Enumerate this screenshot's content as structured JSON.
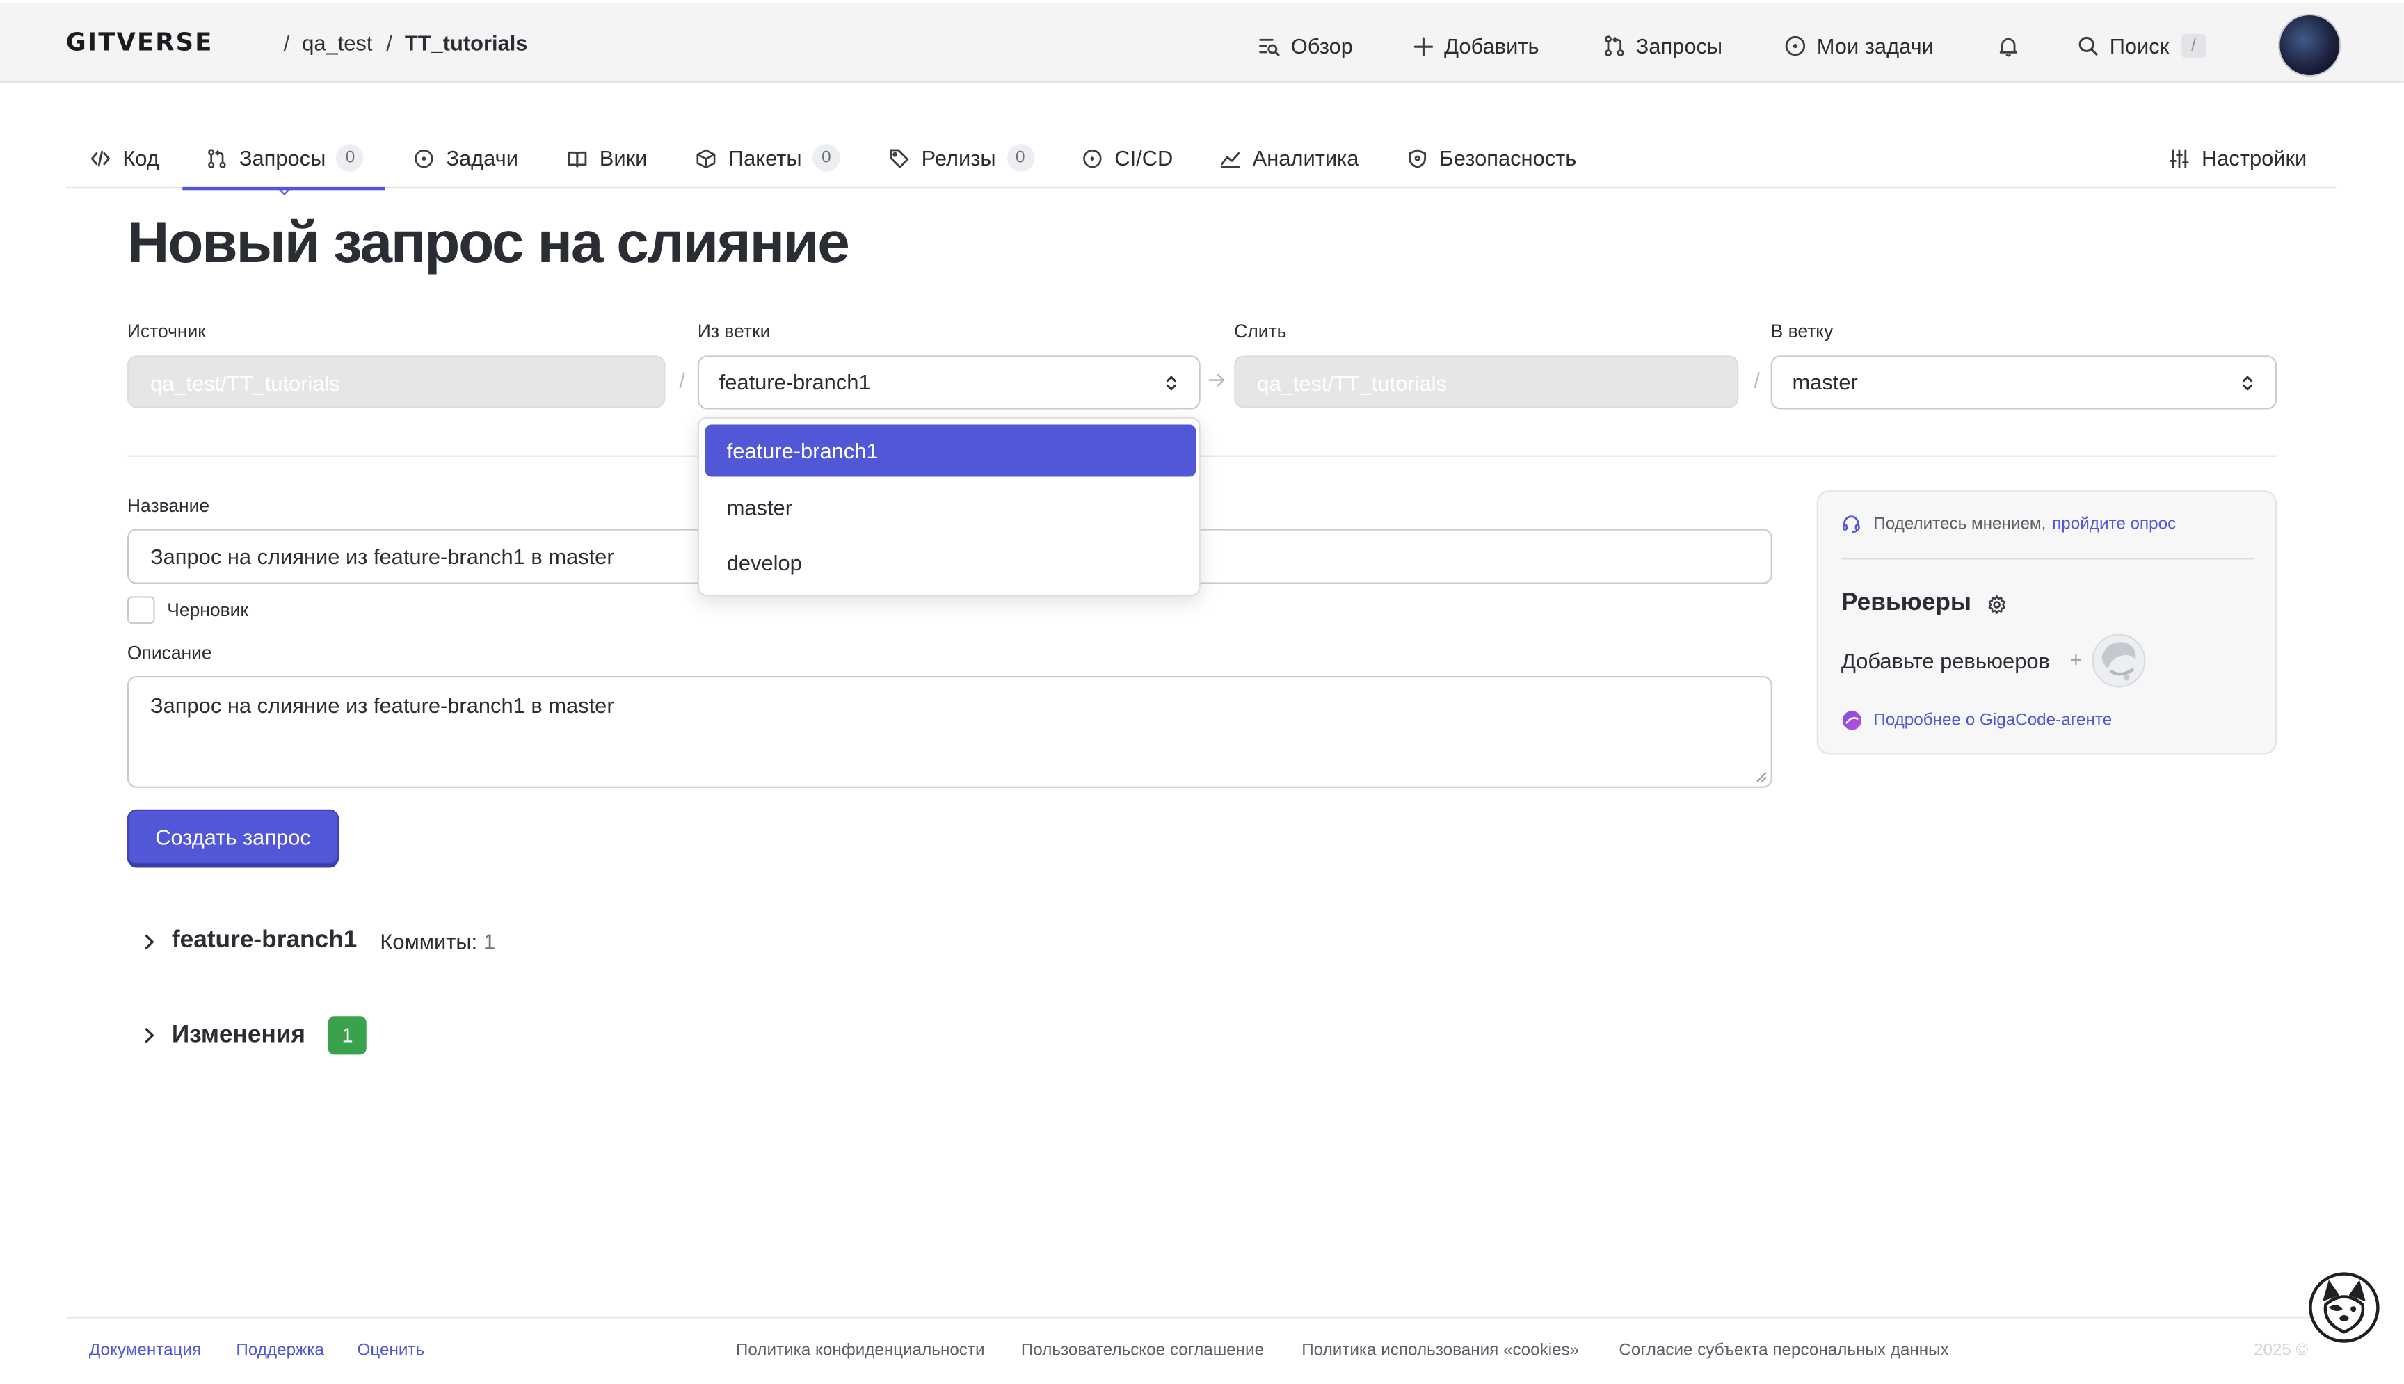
{
  "header": {
    "logo": "GITVERSE",
    "breadcrumb": {
      "owner": "qa_test",
      "separator": "/",
      "repo": "TT_tutorials"
    },
    "nav": {
      "overview": "Обзор",
      "add": "Добавить",
      "requests": "Запросы",
      "my_tasks": "Мои задачи",
      "search": "Поиск",
      "search_shortcut": "/"
    }
  },
  "tabs": [
    {
      "label": "Код"
    },
    {
      "label": "Запросы",
      "count": "0"
    },
    {
      "label": "Задачи"
    },
    {
      "label": "Вики"
    },
    {
      "label": "Пакеты",
      "count": "0"
    },
    {
      "label": "Релизы",
      "count": "0"
    },
    {
      "label": "CI/CD"
    },
    {
      "label": "Аналитика"
    },
    {
      "label": "Безопасность"
    },
    {
      "label": "Настройки"
    }
  ],
  "page_title": "Новый запрос на слияние",
  "branches": {
    "source_label": "Источник",
    "source_value": "qa_test/TT_tutorials",
    "from_branch_label": "Из ветки",
    "from_branch_value": "feature-branch1",
    "merge_label": "Слить",
    "merge_value": "qa_test/TT_tutorials",
    "to_branch_label": "В ветку",
    "to_branch_value": "master",
    "separator": "/"
  },
  "dropdown": {
    "options": [
      "feature-branch1",
      "master",
      "develop"
    ],
    "selected": "feature-branch1"
  },
  "form": {
    "title_label": "Название",
    "title_value": "Запрос на слияние из feature-branch1 в master",
    "draft_label": "Черновик",
    "description_label": "Описание",
    "description_value": "Запрос на слияние из feature-branch1 в master",
    "submit_label": "Создать запрос"
  },
  "side_panel": {
    "feedback_text": "Поделитесь мнением,",
    "feedback_link": "пройдите опрос",
    "reviewers_title": "Ревьюеры",
    "add_reviewers": "Добавьте ревьюеров",
    "plus": "+",
    "gigacode_link": "Подробнее о GigaCode-агенте"
  },
  "sections": {
    "branch_name": "feature-branch1",
    "commits_label": "Коммиты:",
    "commits_count": "1",
    "changes_label": "Изменения",
    "changes_count": "1"
  },
  "footer": {
    "links": [
      "Документация",
      "Поддержка",
      "Оценить"
    ],
    "legal": [
      "Политика конфиденциальности",
      "Пользовательское соглашение",
      "Политика использования «cookies»",
      "Согласие субъекта персональных данных"
    ],
    "copyright": "2025 ©"
  },
  "colors": {
    "accent": "#5157d6",
    "success_badge": "#3aa14d",
    "header_bg": "#f4f4f5",
    "text": "#2a2d33"
  },
  "icons": {
    "overview": "list-search-icon",
    "add": "plus-icon",
    "requests": "git-pull-request-icon",
    "tasks": "circle-dot-icon",
    "notifications": "bell-icon",
    "search": "search-icon",
    "code": "code-icon",
    "wiki": "book-icon",
    "packages": "package-icon",
    "releases": "tag-icon",
    "cicd": "circle-play-icon",
    "analytics": "chart-line-icon",
    "security": "shield-icon",
    "settings": "sliders-icon",
    "reviewer_settings": "gear-icon",
    "feedback": "headset-icon",
    "gigacode": "gigacode-orb-icon",
    "expand": "chevron-right-icon",
    "mascot": "dog-mascot-icon"
  }
}
